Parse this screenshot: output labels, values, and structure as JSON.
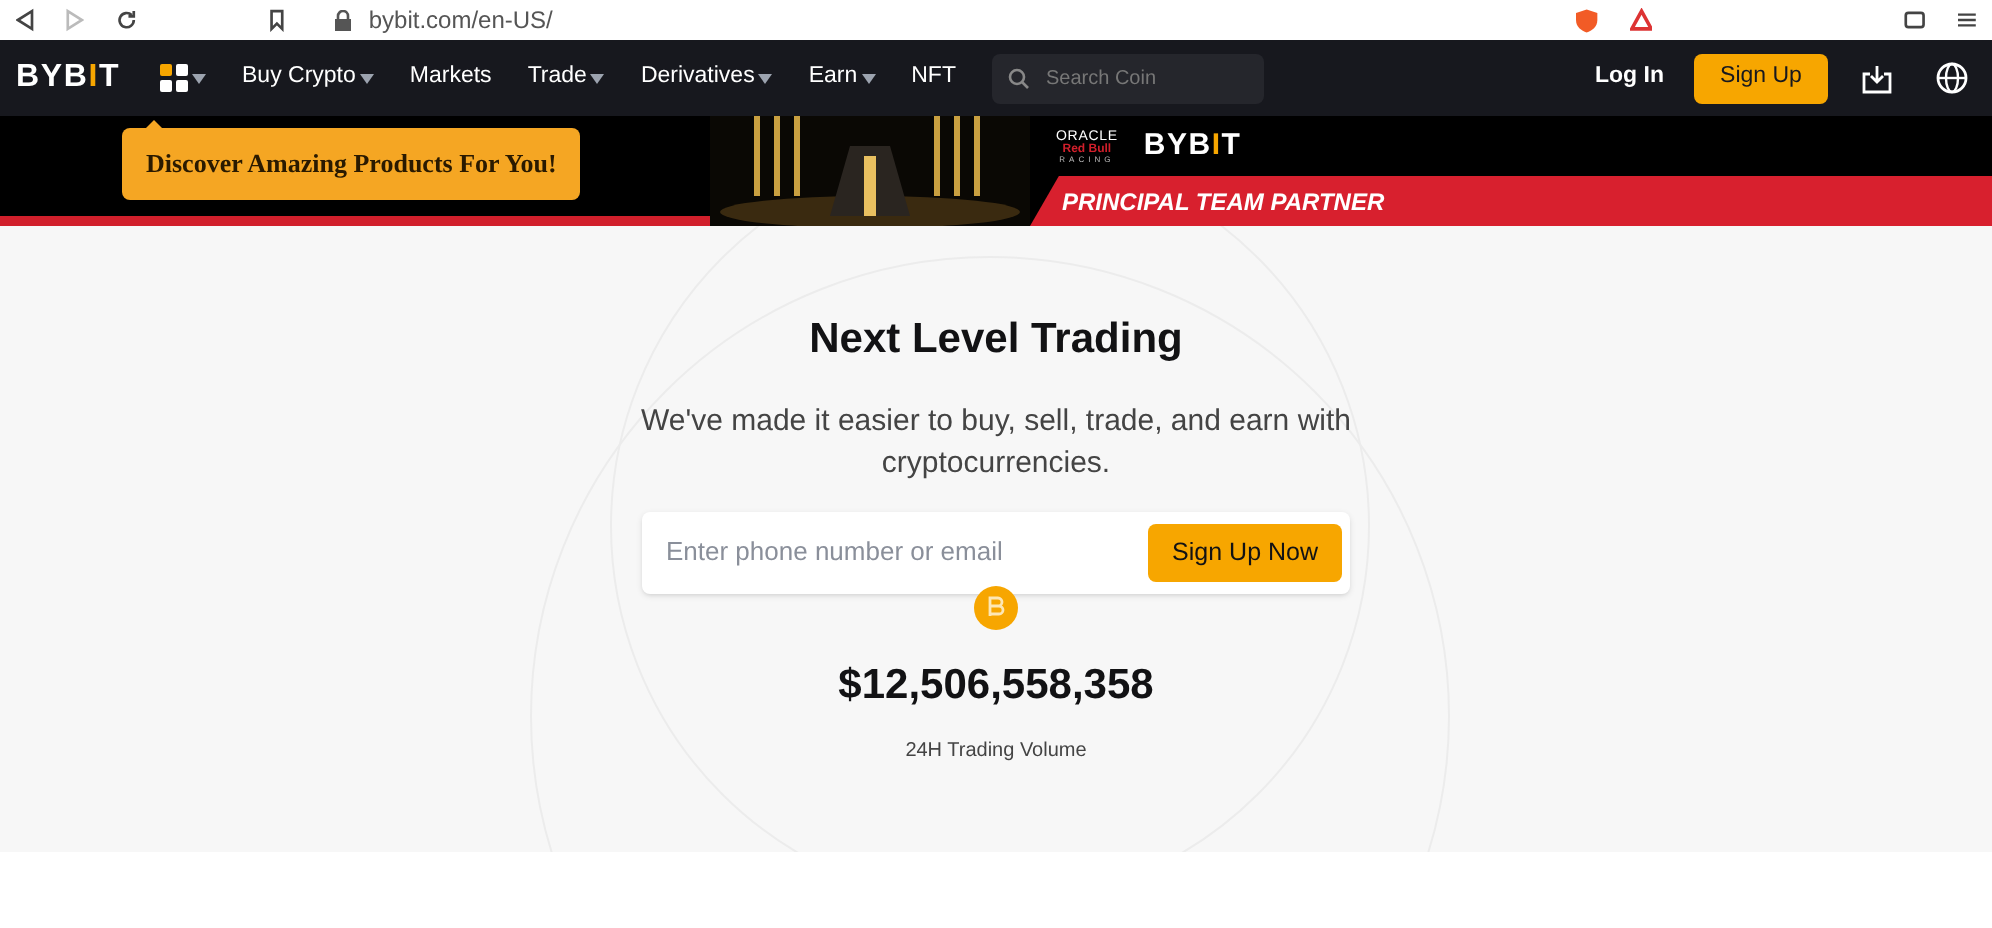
{
  "browser": {
    "address": "bybit.com/en-US/"
  },
  "nav": {
    "logo": "BYBIT",
    "items": [
      {
        "label": "Buy Crypto",
        "has_menu": true
      },
      {
        "label": "Markets",
        "has_menu": false
      },
      {
        "label": "Trade",
        "has_menu": true
      },
      {
        "label": "Derivatives",
        "has_menu": true
      },
      {
        "label": "Earn",
        "has_menu": true
      },
      {
        "label": "NFT",
        "has_menu": false
      }
    ],
    "search": {
      "placeholder": "Search Coin"
    },
    "login": "Log In",
    "signup": "Sign Up"
  },
  "banner": {
    "tooltip": "Discover Amazing Products For You!",
    "sponsor": [
      "ORACLE",
      "Red Bull",
      "RACING"
    ],
    "logo": "BYBIT",
    "tagline": "PRINCIPAL TEAM PARTNER"
  },
  "hero": {
    "title": "Next Level Trading",
    "subtitle": "We've made it easier to buy, sell, trade, and earn with cryptocurrencies.",
    "input": {
      "placeholder": "Enter phone number or email"
    },
    "button": "Sign Up Now",
    "volume": "$12,506,558,358",
    "volume_label": "24H Trading Volume"
  }
}
